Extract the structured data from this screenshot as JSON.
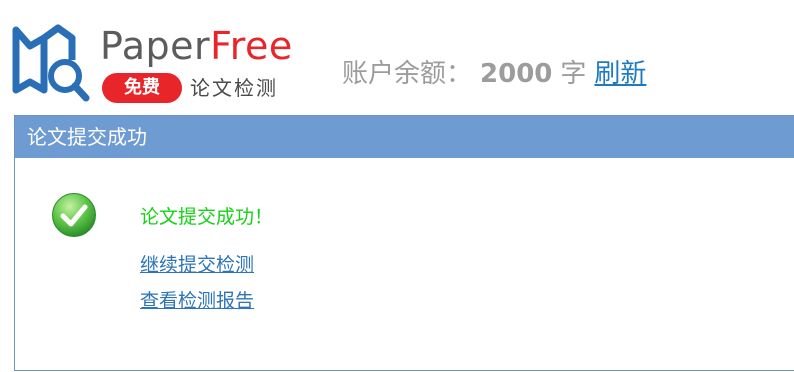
{
  "header": {
    "brand": {
      "part1": "Paper",
      "part2": "Free"
    },
    "badge": "免费",
    "tagline": "论文检测",
    "balance": {
      "label": "账户余额：",
      "value": "2000",
      "unit": "字",
      "refresh": "刷新"
    }
  },
  "panel": {
    "title": "论文提交成功",
    "message": "论文提交成功！",
    "links": [
      "继续提交检测",
      "查看检测报告"
    ]
  },
  "colors": {
    "accent_blue": "#6e9bd1",
    "brand_red": "#e8262a",
    "success_green": "#17d117",
    "link_blue": "#2d74b8"
  }
}
